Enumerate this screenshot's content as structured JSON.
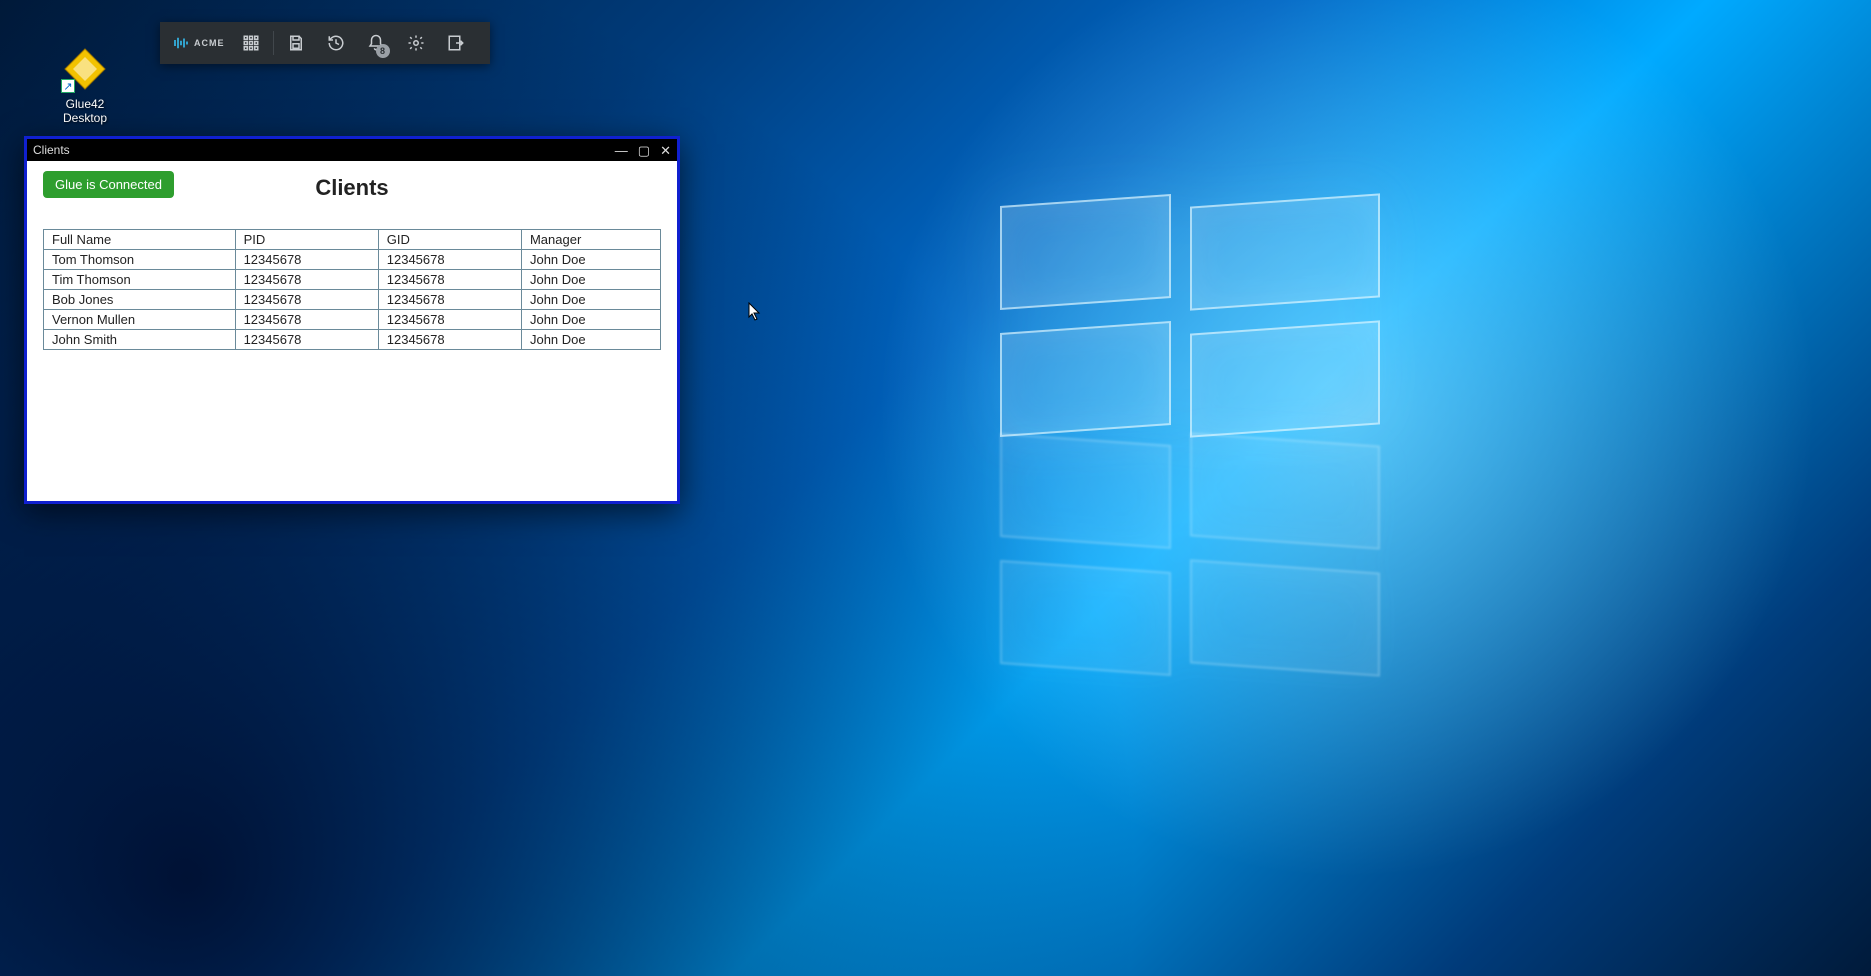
{
  "desktop_icon": {
    "label_line1": "Glue42",
    "label_line2": "Desktop"
  },
  "toolbar": {
    "brand": "ACME",
    "notification_count": "8"
  },
  "window": {
    "title": "Clients",
    "status": "Glue is Connected",
    "heading": "Clients",
    "columns": [
      "Full Name",
      "PID",
      "GID",
      "Manager"
    ],
    "rows": [
      {
        "name": "Tom Thomson",
        "pid": "12345678",
        "gid": "12345678",
        "manager": "John Doe"
      },
      {
        "name": "Tim Thomson",
        "pid": "12345678",
        "gid": "12345678",
        "manager": "John Doe"
      },
      {
        "name": "Bob Jones",
        "pid": "12345678",
        "gid": "12345678",
        "manager": "John Doe"
      },
      {
        "name": "Vernon Mullen",
        "pid": "12345678",
        "gid": "12345678",
        "manager": "John Doe"
      },
      {
        "name": "John Smith",
        "pid": "12345678",
        "gid": "12345678",
        "manager": "John Doe"
      }
    ]
  }
}
